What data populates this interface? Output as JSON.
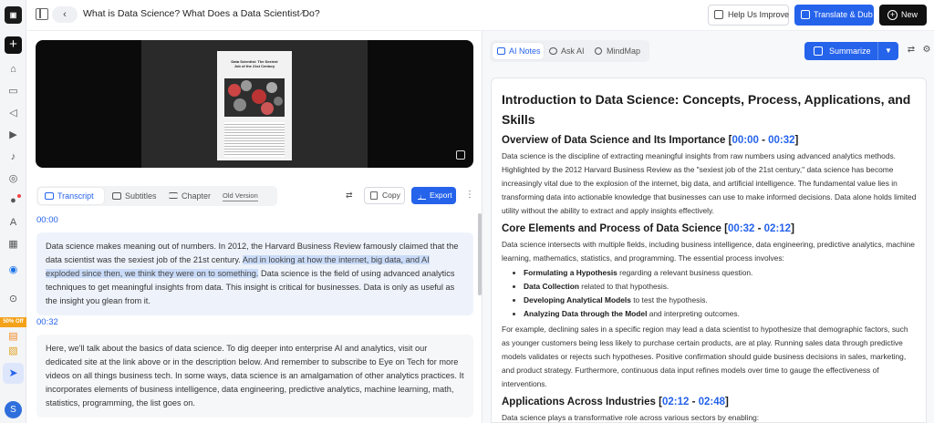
{
  "header": {
    "title": "What is Data Science? What Does a Data Scientist Do?",
    "help_label": "Help Us Improve",
    "translate_label": "Translate & Dub",
    "new_label": "New"
  },
  "rail": {
    "sale_badge": "50% Off",
    "avatar_initial": "S"
  },
  "video": {
    "poster_title": "Data Scientist: The Sexiest Job of the 21st Century"
  },
  "transcript_tabs": {
    "transcript": "Transcript",
    "subtitles": "Subtitles",
    "chapter": "Chapter",
    "old_version": "Old Version",
    "copy": "Copy",
    "export": "Export"
  },
  "transcript": [
    {
      "time": "00:00",
      "text_before": "Data science makes meaning out of numbers. In 2012, the Harvard Business Review famously claimed that the data scientist was the sexiest job of the 21st century. ",
      "highlight": "And in looking at how the internet, big data, and AI exploded since then, we think they were on to something.",
      "text_after": " Data science is the field of using advanced analytics techniques to get meaningful insights from data. This insight is critical for businesses. Data is only as useful as the insight you glean from it."
    },
    {
      "time": "00:32",
      "text": "Here, we'll talk about the basics of data science. To dig deeper into enterprise AI and analytics, visit our dedicated site at the link above or in the description below. And remember to subscribe to Eye on Tech for more videos on all things business tech. In some ways, data science is an amalgamation of other analytics practices. It incorporates elements of business intelligence, data engineering, predictive analytics, machine learning, math, statistics, programming, the list goes on."
    }
  ],
  "right_tabs": {
    "ai_notes": "AI Notes",
    "ask_ai": "Ask AI",
    "mindmap": "MindMap",
    "summarize": "Summarize"
  },
  "notes": {
    "title": "Introduction to Data Science: Concepts, Process, Applications, and Skills",
    "s1": {
      "heading": "Overview of Data Science and Its Importance ",
      "t1": "00:00",
      "t2": "00:32",
      "p": "Data science is the discipline of extracting meaningful insights from raw numbers using advanced analytics methods. Highlighted by the 2012 Harvard Business Review as the \"sexiest job of the 21st century,\" data science has become increasingly vital due to the explosion of the internet, big data, and artificial intelligence. The fundamental value lies in transforming data into actionable knowledge that businesses can use to make informed decisions. Data alone holds limited utility without the ability to extract and apply insights effectively."
    },
    "s2": {
      "heading": "Core Elements and Process of Data Science ",
      "t1": "00:32",
      "t2": "02:12",
      "p": "Data science intersects with multiple fields, including business intelligence, data engineering, predictive analytics, machine learning, mathematics, statistics, and programming. The essential process involves:",
      "items": [
        {
          "b": "Formulating a Hypothesis",
          "t": " regarding a relevant business question."
        },
        {
          "b": "Data Collection",
          "t": " related to that hypothesis."
        },
        {
          "b": "Developing Analytical Models",
          "t": " to test the hypothesis."
        },
        {
          "b": "Analyzing Data through the Model",
          "t": " and interpreting outcomes."
        }
      ],
      "p2": "For example, declining sales in a specific region may lead a data scientist to hypothesize that demographic factors, such as younger customers being less likely to purchase certain products, are at play. Running sales data through predictive models validates or rejects such hypotheses. Positive confirmation should guide business decisions in sales, marketing, and product strategy. Furthermore, continuous data input refines models over time to gauge the effectiveness of interventions."
    },
    "s3": {
      "heading": "Applications Across Industries ",
      "t1": "02:12",
      "t2": "02:48",
      "p": "Data science plays a transformative role across various sectors by enabling:"
    }
  },
  "colors": {
    "accent": "#2563eb",
    "highlight": "#c9dbf8",
    "sale": "#f4a21a"
  }
}
